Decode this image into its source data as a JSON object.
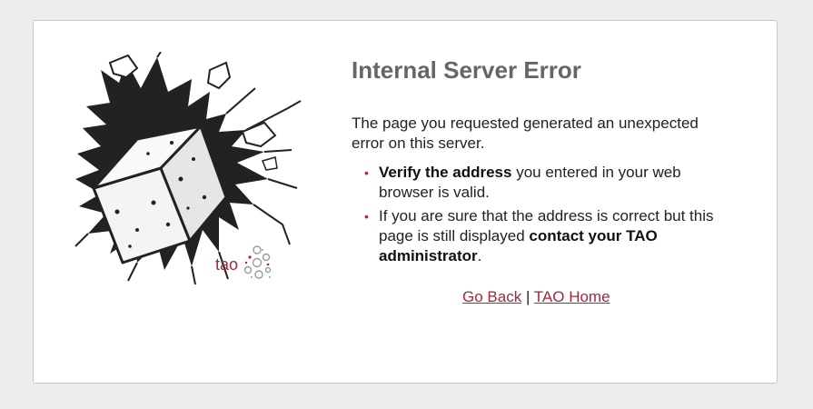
{
  "error": {
    "title": "Internal Server Error",
    "intro": "The page you requested generated an unexpected error on this server."
  },
  "suggestions": [
    {
      "bold_prefix": "Verify the address",
      "text_after": " you entered in your web browser is valid."
    },
    {
      "text_before": "If you are sure that the address is correct but this page is still displayed ",
      "bold_suffix": "contact your TAO administrator",
      "text_after": "."
    }
  ],
  "links": {
    "go_back": "Go Back",
    "separator": "|",
    "tao_home": "TAO Home"
  },
  "logo": {
    "text": "tao"
  },
  "colors": {
    "accent": "#a8263a",
    "title": "#666666",
    "background": "#ececec"
  },
  "icons": {
    "illustration": "broken-wall-cube-illustration",
    "logo": "tao-logo-icon"
  }
}
